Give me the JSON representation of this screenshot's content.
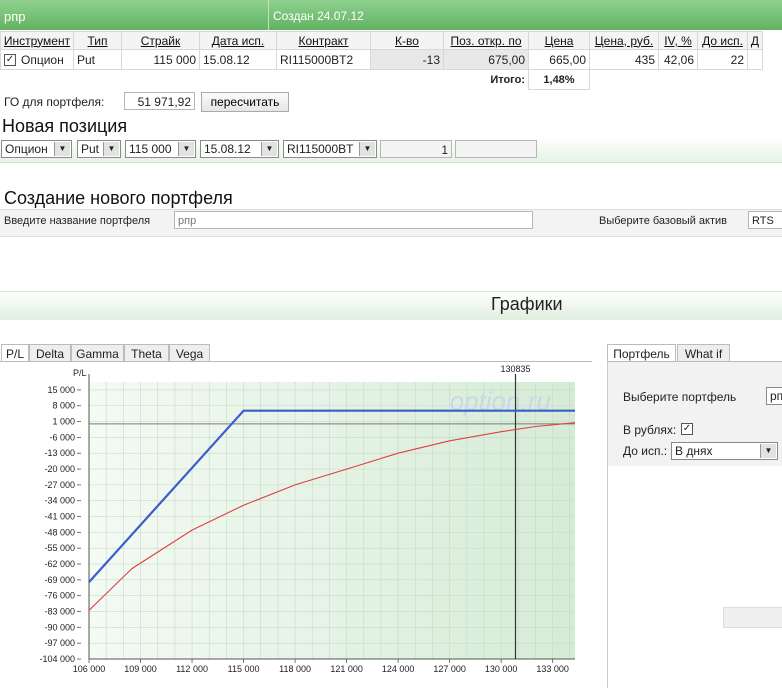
{
  "header": {
    "portfolio_name": "рпр",
    "created": "Создан 24.07.12"
  },
  "table": {
    "columns": [
      "Инструмент",
      "Тип",
      "Страйк",
      "Дата исп.",
      "Контракт",
      "К-во",
      "Поз. откр. по",
      "Цена",
      "Цена, руб.",
      "IV, %",
      "До исп.",
      "Д"
    ],
    "row": {
      "checked": "✓",
      "instrument": "Опцион",
      "type": "Put",
      "strike": "115 000",
      "expiry": "15.08.12",
      "contract": "RI115000BT2",
      "qty": "-13",
      "open_price": "675,00",
      "price": "665,00",
      "price_rub": "435",
      "iv": "42,06",
      "days": "22"
    },
    "total_label": "Итого:",
    "total_value": "1,48%"
  },
  "go": {
    "label": "ГО для портфеля:",
    "value": "51 971,92",
    "recalc_button": "пересчитать"
  },
  "new_position": {
    "title": "Новая позиция",
    "instrument": "Опцион",
    "type": "Put",
    "strike": "115 000",
    "expiry": "15.08.12",
    "contract": "RI115000BT",
    "qty": "1",
    "price": ""
  },
  "new_portfolio": {
    "title": "Создание нового портфеля",
    "name_label": "Введите название портфеля",
    "name_value": "рпр",
    "asset_label": "Выберите базовый актив",
    "asset_value": "RTS"
  },
  "charts_section": {
    "title": "Графики"
  },
  "chart_tabs": [
    "P/L",
    "Delta",
    "Gamma",
    "Theta",
    "Vega"
  ],
  "right_tabs": [
    "Портфель",
    "What if"
  ],
  "right_panel": {
    "portfolio_label": "Выберите портфель",
    "portfolio_value": "рп",
    "rub_label": "В рублях:",
    "rub_checked": "✓",
    "expiry_label": "До исп.:",
    "expiry_value": "В днях"
  },
  "chart_data": {
    "type": "line",
    "ylabel": "P/L",
    "watermark": "option.ru",
    "current_price_label": "130835",
    "current_price": 130835,
    "xlim": [
      106000,
      134300
    ],
    "ylim": [
      -104000,
      18500
    ],
    "x_ticks": [
      106000,
      109000,
      112000,
      115000,
      118000,
      121000,
      124000,
      127000,
      130000,
      133000
    ],
    "x_tick_labels": [
      "106 000",
      "109 000",
      "112 000",
      "115 000",
      "118 000",
      "121 000",
      "124 000",
      "127 000",
      "130 000",
      "133 000"
    ],
    "y_ticks": [
      15000,
      8000,
      1000,
      -6000,
      -13000,
      -20000,
      -27000,
      -34000,
      -41000,
      -48000,
      -55000,
      -62000,
      -69000,
      -76000,
      -83000,
      -90000,
      -97000,
      -104000
    ],
    "y_tick_labels": [
      "15 000",
      "8 000",
      "1 000",
      "-6 000",
      "-13 000",
      "-20 000",
      "-27 000",
      "-34 000",
      "-41 000",
      "-48 000",
      "-55 000",
      "-62 000",
      "-69 000",
      "-76 000",
      "-83 000",
      "-90 000",
      "-97 000",
      "-104 000"
    ],
    "series": [
      {
        "color": "#3a5ccc",
        "x": [
          106000,
          115000,
          134300
        ],
        "y": [
          -70000,
          5800,
          5800
        ]
      },
      {
        "color": "#e04040",
        "x": [
          106000,
          108500,
          112000,
          115000,
          118000,
          121000,
          124000,
          127000,
          130000,
          132000,
          134300
        ],
        "y": [
          -82500,
          -64000,
          -47000,
          -36000,
          -27000,
          -20000,
          -13000,
          -7500,
          -3500,
          -1200,
          500
        ]
      }
    ]
  },
  "colors": {
    "header_green": "#62b362",
    "accent_green": "#e6f3e6"
  }
}
